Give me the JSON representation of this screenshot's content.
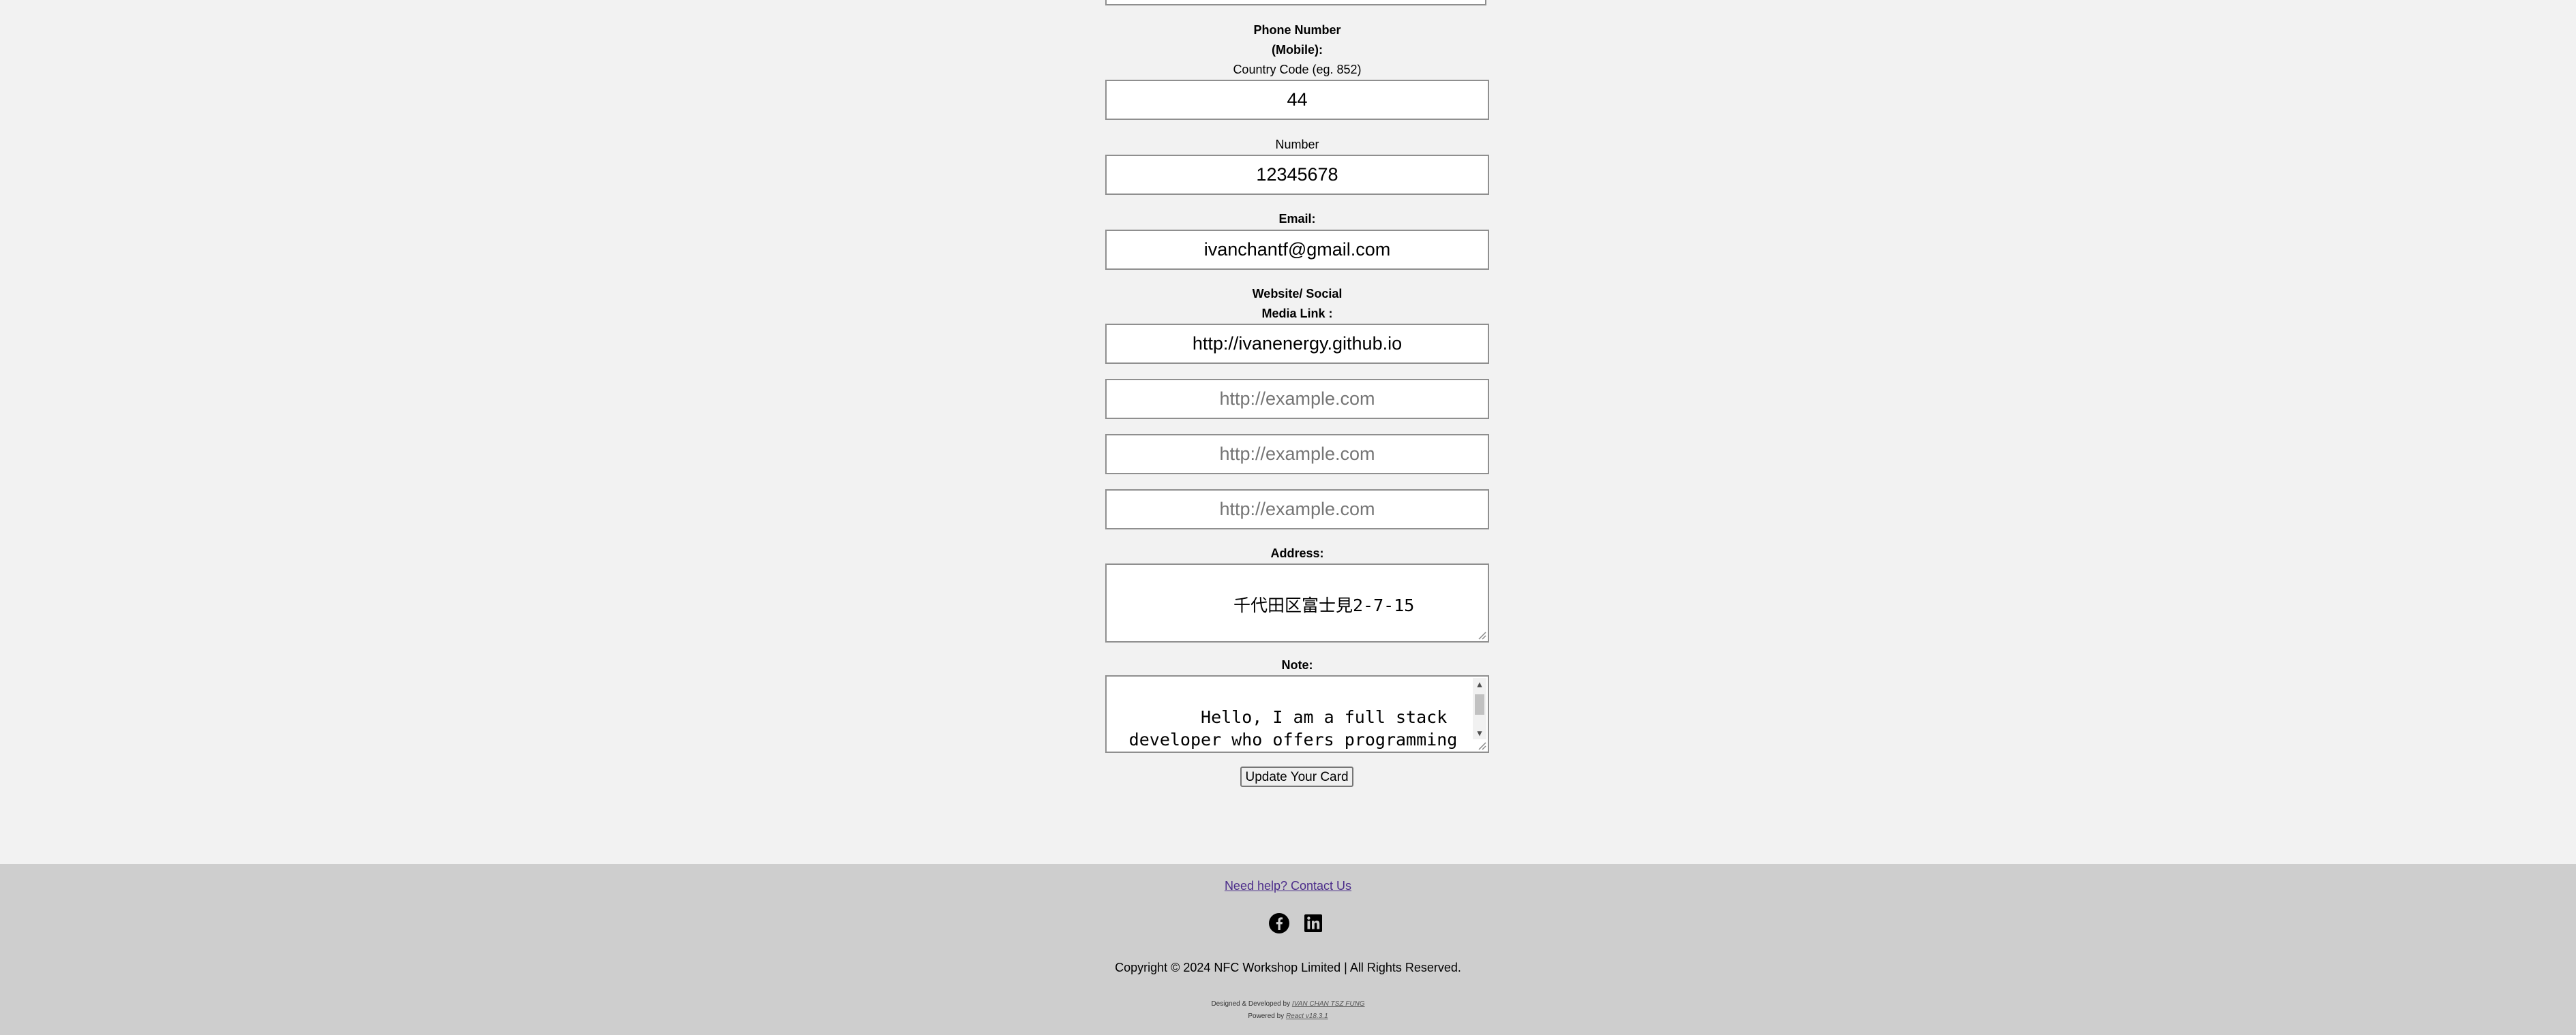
{
  "phone": {
    "label_line1": "Phone Number",
    "label_line2": "(Mobile):",
    "country_code_label": "Country Code (eg. 852)",
    "country_code_value": "44",
    "number_label": "Number",
    "number_value": "12345678"
  },
  "email": {
    "label": "Email:",
    "value": "ivanchantf@gmail.com"
  },
  "website": {
    "label_line1": "Website/ Social",
    "label_line2": "Media Link :",
    "links": [
      {
        "value": "http://ivanenergy.github.io",
        "placeholder": "http://example.com"
      },
      {
        "value": "",
        "placeholder": "http://example.com"
      },
      {
        "value": "",
        "placeholder": "http://example.com"
      },
      {
        "value": "",
        "placeholder": "http://example.com"
      }
    ]
  },
  "address": {
    "label": "Address:",
    "value": "千代田区富士見2-7-15"
  },
  "note": {
    "label": "Note:",
    "value": "Hello, I am a full stack developer who offers programming services for Android/iOS/Web"
  },
  "update_button_label": "Update Your Card",
  "footer": {
    "help_link": "Need help? Contact Us",
    "social_icons": [
      "facebook-icon",
      "linkedin-icon"
    ],
    "copyright": "Copyright © 2024 NFC Workshop Limited | All Rights Reserved.",
    "designed_prefix": "Designed & Developed by",
    "designer": "IVAN CHAN TSZ FUNG",
    "powered_prefix": "Powered by",
    "powered_by": "React v18.3.1"
  },
  "colors": {
    "page_background": "#f2f2f2",
    "footer_background": "#cecece",
    "link": "#4b2c8a",
    "field_border": "#8f8f8f"
  }
}
